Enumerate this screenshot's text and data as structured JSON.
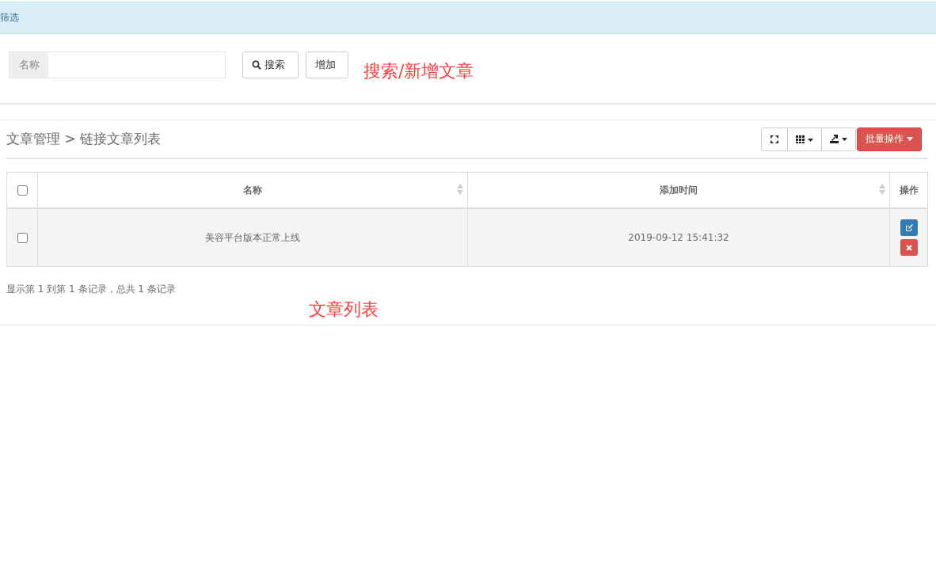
{
  "filter_header": {
    "title": "筛选"
  },
  "search": {
    "label": "名称",
    "buttons": [
      "搜索",
      "增加"
    ],
    "annotation": "搜索/新增文章"
  },
  "list": {
    "breadcrumb": "文章管理 > 链接文章列表",
    "toolbar": {
      "batch_label": "批量操作"
    },
    "table": {
      "header_checked": false,
      "columns": [
        {
          "label": "名称",
          "sortable": true
        },
        {
          "label": "添加时间",
          "sortable": true
        },
        {
          "label": "操作",
          "sortable": false
        }
      ],
      "rows": [
        {
          "checked": false,
          "cells": [
            "美容平台版本正常上线",
            "2019-09-12 15:41:32"
          ]
        }
      ]
    },
    "summary": "显示第 1 到第 1 条记录，总共 1 条记录",
    "annotation": "文章列表"
  }
}
